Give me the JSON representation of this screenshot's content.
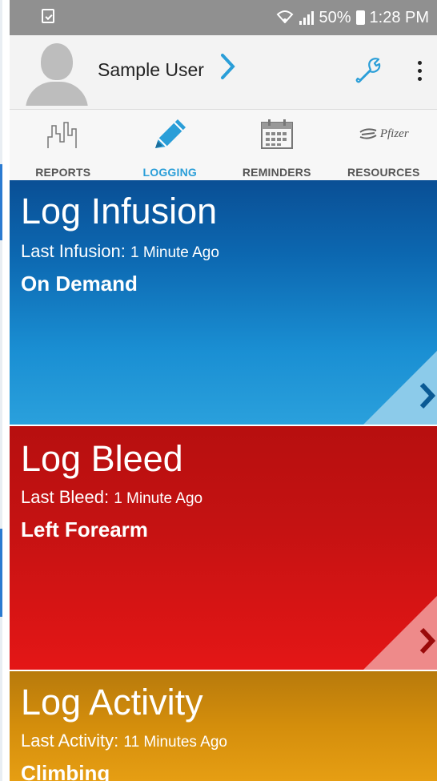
{
  "status_bar": {
    "battery_percent": "50%",
    "time": "1:28 PM",
    "icons": [
      "task-check-icon",
      "wifi-icon",
      "signal-icon",
      "battery-icon"
    ]
  },
  "header": {
    "user_name": "Sample User",
    "icons": [
      "avatar-icon",
      "chevron-right-icon",
      "wrench-icon",
      "more-vert-icon"
    ]
  },
  "tabs": [
    {
      "label": "REPORTS",
      "icon": "reports-chart-icon",
      "active": false
    },
    {
      "label": "LOGGING",
      "icon": "pencil-icon",
      "active": true
    },
    {
      "label": "REMINDERS",
      "icon": "calendar-icon",
      "active": false
    },
    {
      "label": "RESOURCES",
      "icon": "pfizer-logo-icon",
      "active": false,
      "logo_text": "Pfizer"
    }
  ],
  "cards": {
    "infusion": {
      "title": "Log Infusion",
      "last_label": "Last Infusion:",
      "last_value": "1 Minute Ago",
      "detail": "On Demand",
      "color": "#0c67b0"
    },
    "bleed": {
      "title": "Log Bleed",
      "last_label": "Last Bleed:",
      "last_value": "1 Minute Ago",
      "detail": "Left Forearm",
      "color": "#d51414"
    },
    "activity": {
      "title": "Log Activity",
      "last_label": "Last Activity:",
      "last_value": "11 Minutes Ago",
      "detail": "Climbing",
      "color": "#d48e0c"
    }
  },
  "colors": {
    "accent": "#2a9ed8",
    "status_bar": "#909090"
  }
}
